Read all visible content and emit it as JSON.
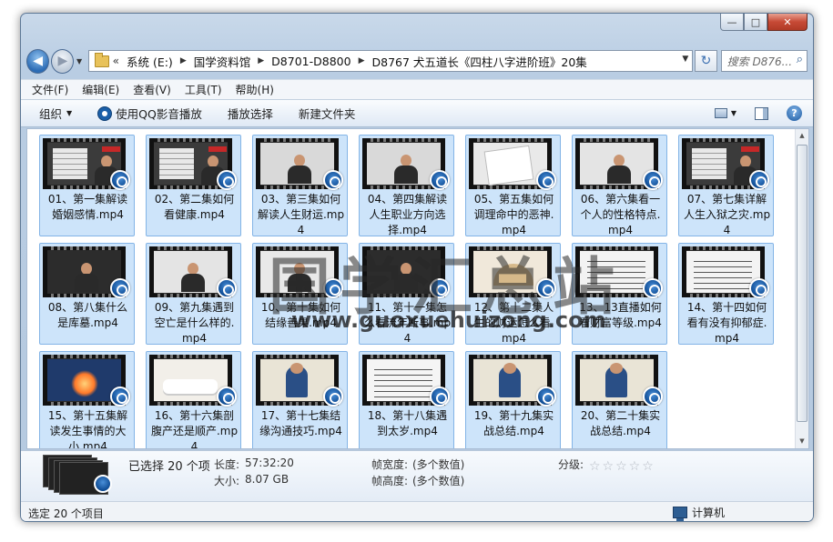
{
  "window": {
    "buttons": {
      "minimize": "—",
      "maximize": "□",
      "close": "✕"
    }
  },
  "nav": {
    "back_glyph": "◀",
    "forward_glyph": "▶",
    "dropdown_glyph": "▼",
    "breadcrumb_lead": "«",
    "breadcrumbs": [
      "系统 (E:)",
      "国学资料馆",
      "D8701-D8800",
      "D8767 犬五道长《四柱八字进阶班》20集"
    ],
    "separator": "▶",
    "refresh_glyph": "↻",
    "search_placeholder": "搜索 D876...",
    "search_glyph": "⌕"
  },
  "menu": [
    "文件(F)",
    "编辑(E)",
    "查看(V)",
    "工具(T)",
    "帮助(H)"
  ],
  "commands": {
    "organize": "组织",
    "play_qq": "使用QQ影音播放",
    "play_selection": "播放选择",
    "new_folder": "新建文件夹",
    "dropdown_glyph": "▼",
    "help_glyph": "?"
  },
  "files": [
    {
      "name": "01、第一集解读婚姻感情.mp4",
      "theme": "#3b3b3b",
      "thumb": "table"
    },
    {
      "name": "02、第二集如何看健康.mp4",
      "theme": "#3b3b3b",
      "thumb": "table"
    },
    {
      "name": "03、第三集如何解读人生财运.mp4",
      "theme": "#d9d9d9",
      "thumb": "person"
    },
    {
      "name": "04、第四集解读人生职业方向选择.mp4",
      "theme": "#d9d9d9",
      "thumb": "person"
    },
    {
      "name": "05、第五集如何调理命中的恶神.mp4",
      "theme": "#e9e9e9",
      "thumb": "paper"
    },
    {
      "name": "06、第六集看一个人的性格特点.mp4",
      "theme": "#e4e4e4",
      "thumb": "person"
    },
    {
      "name": "07、第七集详解人生入狱之灾.mp4",
      "theme": "#3b3b3b",
      "thumb": "table"
    },
    {
      "name": "08、第八集什么是库墓.mp4",
      "theme": "#2c2c2c",
      "thumb": "person"
    },
    {
      "name": "09、第九集遇到空亡是什么样的.mp4",
      "theme": "#e4e4e4",
      "thumb": "person"
    },
    {
      "name": "10、第十集如何结缘善果.mp4",
      "theme": "#e9e9e9",
      "thumb": "person"
    },
    {
      "name": "11、第十一集怎么看流年断事.mp4",
      "theme": "#2c2c2c",
      "thumb": "person"
    },
    {
      "name": "12、第十二集人生的财运怎么看.mp4",
      "theme": "#f0e8da",
      "thumb": "fan"
    },
    {
      "name": "13、13直播如何看财富等级.mp4",
      "theme": "#f3f3f3",
      "thumb": "text"
    },
    {
      "name": "14、第十四如何看有没有抑郁症.mp4",
      "theme": "#f3f3f3",
      "thumb": "text"
    },
    {
      "name": "15、第十五集解读发生事情的大小.mp4",
      "theme": "#1f3a6b",
      "thumb": "glow"
    },
    {
      "name": "16、第十六集剖腹产还是顺产.mp4",
      "theme": "#f2efe9",
      "thumb": "bed"
    },
    {
      "name": "17、第十七集结缘沟通技巧.mp4",
      "theme": "#e9e4d6",
      "thumb": "figure"
    },
    {
      "name": "18、第十八集遇到太岁.mp4",
      "theme": "#f5f5f5",
      "thumb": "text"
    },
    {
      "name": "19、第十九集实战总结.mp4",
      "theme": "#e9e4d6",
      "thumb": "figure"
    },
    {
      "name": "20、第二十集实战总结.mp4",
      "theme": "#e9e4d6",
      "thumb": "figure"
    }
  ],
  "watermark": {
    "main": "国学汇总站",
    "url": "www.guoxuehuizong.com"
  },
  "details": {
    "selected": "已选择 20 个项",
    "length_key": "长度:",
    "length_val": "57:32:20",
    "size_key": "大小:",
    "size_val": "8.07 GB",
    "fw_key": "帧宽度:",
    "fw_val": "(多个数值)",
    "fh_key": "帧高度:",
    "fh_val": "(多个数值)",
    "rating_key": "分级:",
    "rating_stars": "☆☆☆☆☆"
  },
  "status": {
    "left": "选定 20 个项目",
    "right": "计算机"
  }
}
